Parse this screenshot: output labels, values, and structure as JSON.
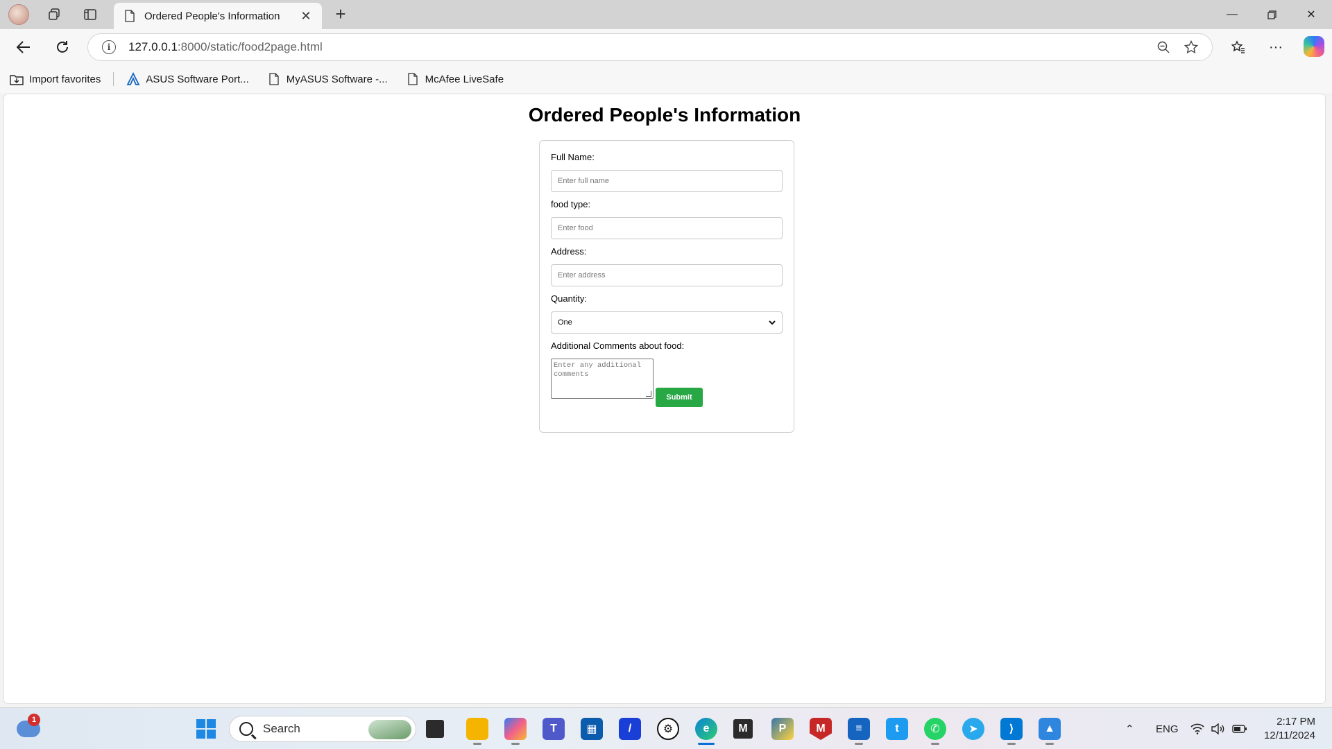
{
  "browser": {
    "tab_title": "Ordered People's Information",
    "url_host": "127.0.0.1",
    "url_rest": ":8000/static/food2page.html",
    "new_tab": "+",
    "close_tab": "✕"
  },
  "favorites": [
    {
      "label": "Import favorites",
      "icon": "import-favorites-icon"
    },
    {
      "label": "ASUS Software Port...",
      "icon": "asus-icon"
    },
    {
      "label": "MyASUS Software -...",
      "icon": "page-icon"
    },
    {
      "label": "McAfee LiveSafe",
      "icon": "page-icon"
    }
  ],
  "page": {
    "title": "Ordered People's Information",
    "form": {
      "full_name_label": "Full Name:",
      "full_name_placeholder": "Enter full name",
      "food_type_label": "food type:",
      "food_placeholder": "Enter food",
      "address_label": "Address:",
      "address_placeholder": "Enter address",
      "quantity_label": "Quantity:",
      "quantity_value": "One",
      "comments_label": "Additional Comments about food:",
      "comments_placeholder": "Enter any additional comments",
      "submit_label": "Submit"
    }
  },
  "taskbar": {
    "search_label": "Search",
    "weather_badge": "1",
    "language": "ENG",
    "time": "2:17 PM",
    "date": "12/11/2024"
  },
  "colors": {
    "submit_bg": "#28a745",
    "tab_bar": "#d3d3d3"
  }
}
